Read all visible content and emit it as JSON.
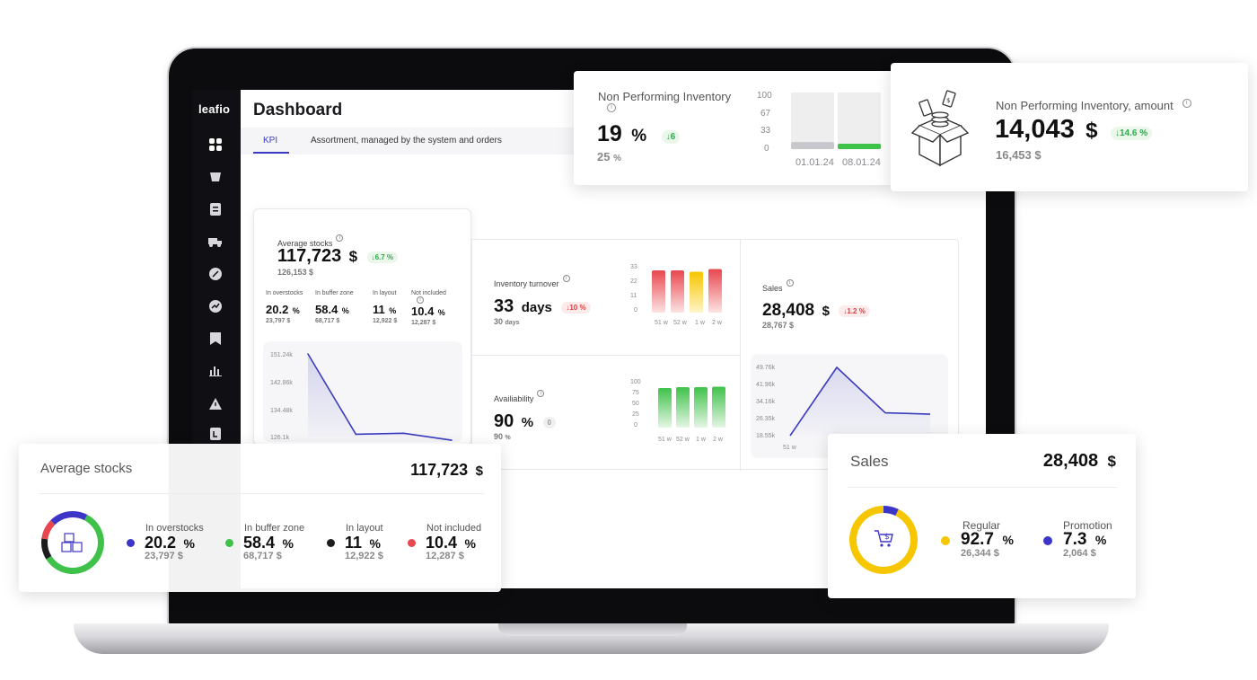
{
  "app": {
    "logo": "leafio",
    "page_title": "Dashboard"
  },
  "tabs": [
    {
      "label": "KPI"
    },
    {
      "label": "Assortment, managed by the system and orders"
    }
  ],
  "avg_stocks_panel": {
    "label": "Average stocks",
    "value": "117,723",
    "unit": "$",
    "delta": "↓6.7 %",
    "prev": "126,153",
    "breakdown": [
      {
        "label": "In overstocks",
        "value": "20.2",
        "unit": "%",
        "amount": "23,797"
      },
      {
        "label": "In buffer zone",
        "value": "58.4",
        "unit": "%",
        "amount": "68,717"
      },
      {
        "label": "In layout",
        "value": "11",
        "unit": "%",
        "amount": "12,922"
      },
      {
        "label": "Not included",
        "value": "10.4",
        "unit": "%",
        "amount": "12,287"
      }
    ],
    "chart_ticks": [
      "151.24k",
      "142.86k",
      "134.48k",
      "126.1k"
    ]
  },
  "turnover_panel": {
    "label": "Inventory turnover",
    "value": "33",
    "unit": "days",
    "delta": "↓10 %",
    "prev": "30",
    "prev_unit": "days",
    "y_ticks": [
      "33",
      "22",
      "11",
      "0"
    ],
    "x_ticks": [
      "51 w",
      "52 w",
      "1 w",
      "2 w"
    ]
  },
  "availability_panel": {
    "label": "Availiability",
    "value": "90",
    "unit": "%",
    "delta": "0",
    "prev": "90",
    "prev_unit": "%",
    "y_ticks": [
      "100",
      "75",
      "50",
      "25",
      "0"
    ],
    "x_ticks": [
      "51 w",
      "52 w",
      "1 w",
      "2 w"
    ]
  },
  "sales_panel": {
    "label": "Sales",
    "value": "28,408",
    "unit": "$",
    "delta": "↓1.2 %",
    "prev": "28,767",
    "y_ticks": [
      "49.76k",
      "41.96k",
      "34.16k",
      "26.35k",
      "18.55k"
    ],
    "x_ticks": [
      "51 w"
    ]
  },
  "npi_card": {
    "label": "Non Performing Inventory",
    "value": "19",
    "unit": "%",
    "delta": "↓6",
    "prev": "25",
    "prev_unit": "%",
    "y_ticks": [
      "100",
      "67",
      "33",
      "0"
    ],
    "x_ticks": [
      "01.01.24",
      "08.01.24"
    ]
  },
  "npi_amount_card": {
    "label": "Non Performing Inventory, amount",
    "value": "14,043",
    "unit": "$",
    "delta": "↓14.6 %",
    "prev": "16,453",
    "prev_unit": "$"
  },
  "avg_stocks_card": {
    "label": "Average stocks",
    "value": "117,723",
    "unit": "$",
    "items": [
      {
        "label": "In overstocks",
        "value": "20.2",
        "unit": "%",
        "amount": "23,797",
        "amount_unit": "$",
        "color": "#3d35c8"
      },
      {
        "label": "In buffer zone",
        "value": "58.4",
        "unit": "%",
        "amount": "68,717",
        "amount_unit": "$",
        "color": "#3fc24a"
      },
      {
        "label": "In layout",
        "value": "11",
        "unit": "%",
        "amount": "12,922",
        "amount_unit": "$",
        "color": "#1c1c1e"
      },
      {
        "label": "Not included",
        "value": "10.4",
        "unit": "%",
        "amount": "12,287",
        "amount_unit": "$",
        "color": "#e8474f"
      }
    ]
  },
  "sales_card": {
    "label": "Sales",
    "value": "28,408",
    "unit": "$",
    "items": [
      {
        "label": "Regular",
        "value": "92.7",
        "unit": "%",
        "amount": "26,344",
        "amount_unit": "$",
        "color": "#f6c600"
      },
      {
        "label": "Promotion",
        "value": "7.3",
        "unit": "%",
        "amount": "2,064",
        "amount_unit": "$",
        "color": "#3d35c8"
      }
    ]
  },
  "colors": {
    "accent": "#3b3bbf",
    "green": "#3fc24a",
    "red": "#e8474f",
    "yellow": "#f6c600"
  },
  "chart_data": [
    {
      "type": "line",
      "title": "",
      "x": [
        1,
        2,
        3,
        4
      ],
      "values": [
        151240,
        126800,
        127100,
        125000
      ],
      "ylim": [
        126100,
        151240
      ]
    },
    {
      "type": "bar",
      "categories": [
        "51 w",
        "52 w",
        "1 w",
        "2 w"
      ],
      "values": [
        31,
        31,
        30,
        32
      ],
      "ylim": [
        0,
        33
      ]
    },
    {
      "type": "bar",
      "categories": [
        "51 w",
        "52 w",
        "1 w",
        "2 w"
      ],
      "values": [
        88,
        90,
        90,
        91
      ],
      "ylim": [
        0,
        100
      ]
    },
    {
      "type": "line",
      "categories": [
        "51 w",
        "52 w",
        "1 w",
        "2 w"
      ],
      "values": [
        18550,
        49760,
        29000,
        28400
      ],
      "ylim": [
        18550,
        49760
      ]
    },
    {
      "type": "bar",
      "categories": [
        "01.01.24",
        "08.01.24"
      ],
      "values": [
        25,
        19
      ],
      "ylim": [
        0,
        100
      ]
    },
    {
      "type": "pie",
      "categories": [
        "In overstocks",
        "In buffer zone",
        "In layout",
        "Not included"
      ],
      "values": [
        20.2,
        58.4,
        11,
        10.4
      ]
    },
    {
      "type": "pie",
      "categories": [
        "Regular",
        "Promotion"
      ],
      "values": [
        92.7,
        7.3
      ]
    }
  ]
}
